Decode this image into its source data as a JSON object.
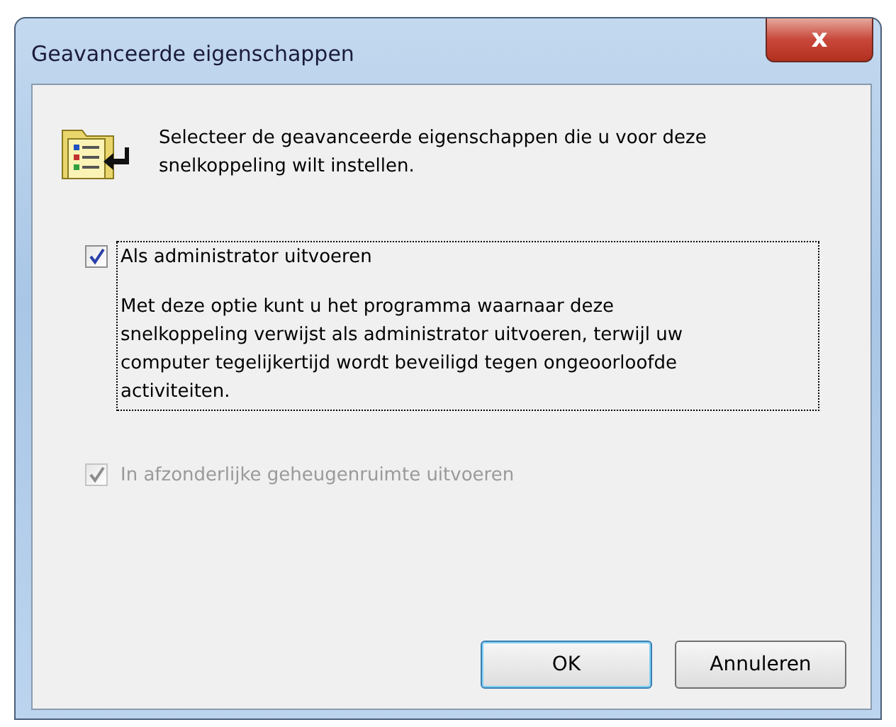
{
  "window": {
    "title": "Geavanceerde eigenschappen",
    "close_button": "x"
  },
  "intro": "Selecteer de geavanceerde eigenschappen die u voor deze snelkoppeling wilt instellen.",
  "options": [
    {
      "label": "Als administrator uitvoeren",
      "checked": true,
      "disabled": false,
      "focused": true,
      "description": "Met deze optie kunt u het programma waarnaar deze snelkoppeling verwijst als administrator uitvoeren, terwijl uw computer tegelijkertijd wordt beveiligd tegen ongeoorloofde activiteiten."
    },
    {
      "label": "In afzonderlijke geheugenruimte uitvoeren",
      "checked": true,
      "disabled": true,
      "focused": false
    }
  ],
  "buttons": [
    {
      "label": "OK",
      "default": true
    },
    {
      "label": "Annuleren",
      "default": false
    }
  ]
}
